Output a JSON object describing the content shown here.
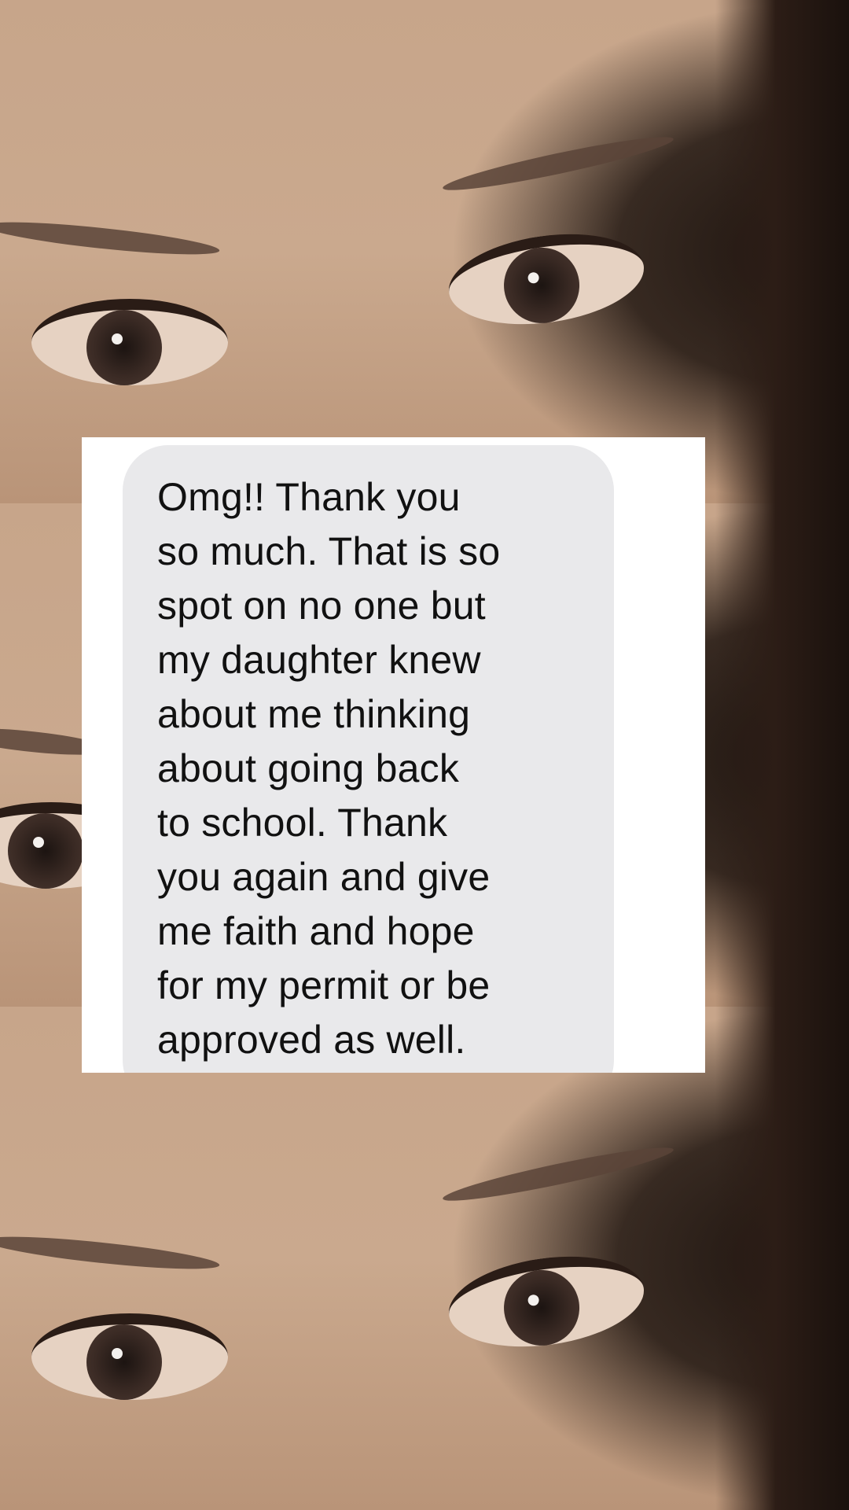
{
  "message": {
    "lines": [
      "Omg!! Thank you",
      "so much. That is so",
      "spot on no one but",
      "my daughter knew",
      "about me thinking",
      "about going back",
      "to school. Thank",
      "you again and give",
      "me faith and hope",
      "for my permit or be",
      "approved as well."
    ]
  },
  "colors": {
    "bubble": "#e9e9eb",
    "screenshot_background": "#ffffff",
    "text": "#111111",
    "skin": "#c7a58a",
    "hair": "#1e140f"
  }
}
